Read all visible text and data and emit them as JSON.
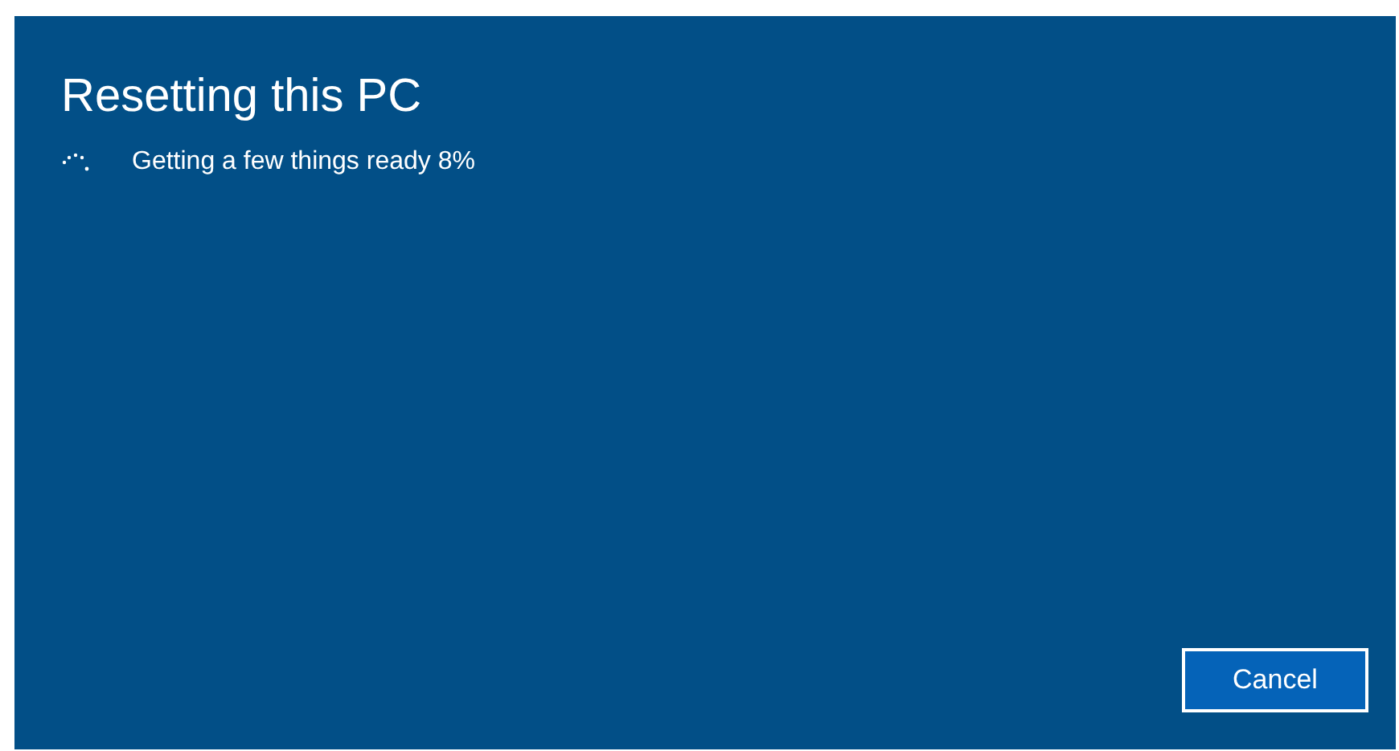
{
  "title": "Resetting this PC",
  "status": {
    "text": "Getting a few things ready 8%"
  },
  "buttons": [
    {
      "label": "Cancel"
    }
  ]
}
